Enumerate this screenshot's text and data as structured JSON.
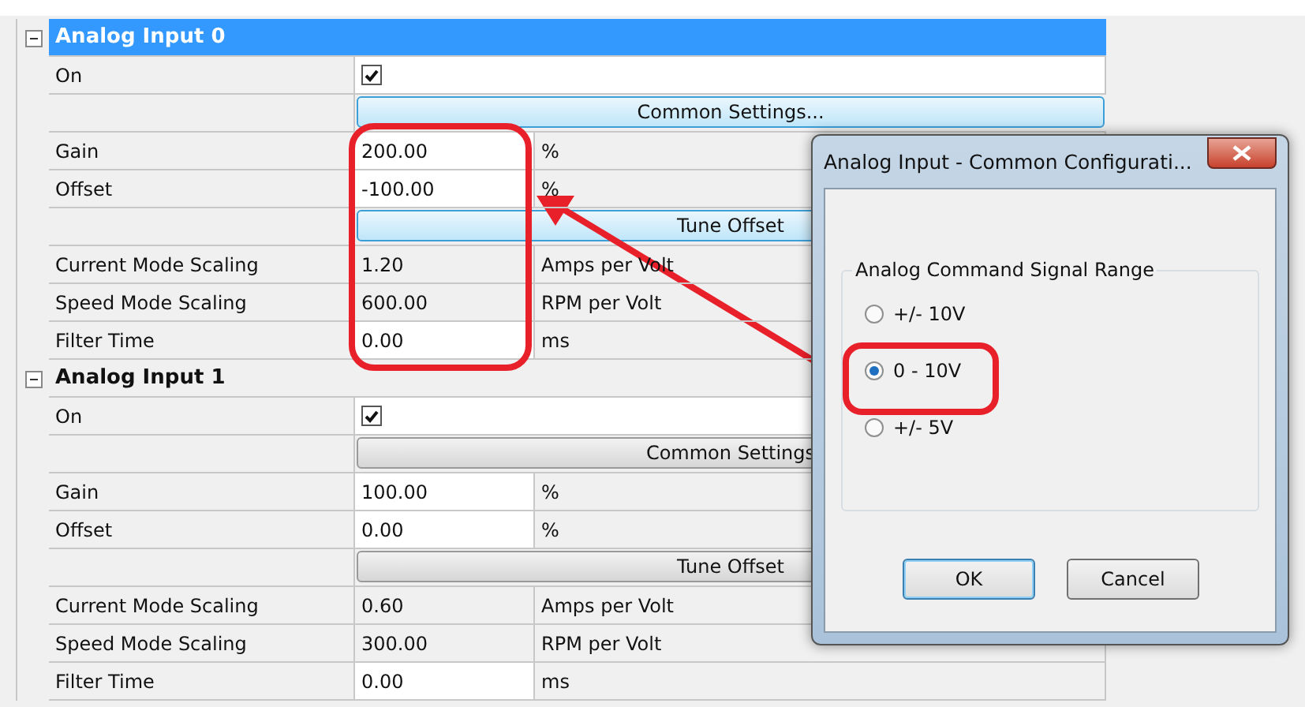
{
  "groups": [
    {
      "title": "Analog Input 0",
      "expanded": true,
      "selected": true,
      "rows": [
        {
          "kind": "checkbox",
          "label": "On",
          "checked": true
        },
        {
          "kind": "button",
          "label": "Common Settings..."
        },
        {
          "kind": "field",
          "label": "Gain",
          "value": "200.00",
          "unit": "%",
          "editable": true
        },
        {
          "kind": "field",
          "label": "Offset",
          "value": "-100.00",
          "unit": "%",
          "editable": true
        },
        {
          "kind": "button",
          "label": "Tune Offset"
        },
        {
          "kind": "field",
          "label": "Current Mode Scaling",
          "value": "1.20",
          "unit": "Amps per Volt",
          "editable": false
        },
        {
          "kind": "field",
          "label": "Speed Mode Scaling",
          "value": "600.00",
          "unit": "RPM per Volt",
          "editable": false
        },
        {
          "kind": "field",
          "label": "Filter Time",
          "value": "0.00",
          "unit": "ms",
          "editable": true
        }
      ]
    },
    {
      "title": "Analog Input 1",
      "expanded": true,
      "selected": false,
      "rows": [
        {
          "kind": "checkbox",
          "label": "On",
          "checked": true
        },
        {
          "kind": "button",
          "label": "Common Settings"
        },
        {
          "kind": "field",
          "label": "Gain",
          "value": "100.00",
          "unit": "%",
          "editable": true
        },
        {
          "kind": "field",
          "label": "Offset",
          "value": "0.00",
          "unit": "%",
          "editable": true
        },
        {
          "kind": "button",
          "label": "Tune Offset"
        },
        {
          "kind": "field",
          "label": "Current Mode Scaling",
          "value": "0.60",
          "unit": "Amps per Volt",
          "editable": false
        },
        {
          "kind": "field",
          "label": "Speed Mode Scaling",
          "value": "300.00",
          "unit": "RPM per Volt",
          "editable": false
        },
        {
          "kind": "field",
          "label": "Filter Time",
          "value": "0.00",
          "unit": "ms",
          "editable": true
        }
      ]
    }
  ],
  "dialog": {
    "title": "Analog Input - Common Configurati...",
    "group_title": "Analog Command Signal Range",
    "options": [
      {
        "label": "+/- 10V",
        "selected": false
      },
      {
        "label": "0 - 10V",
        "selected": true
      },
      {
        "label": "+/- 5V",
        "selected": false
      }
    ],
    "buttons": [
      {
        "label": "OK",
        "default": true
      },
      {
        "label": "Cancel",
        "default": false
      }
    ]
  }
}
